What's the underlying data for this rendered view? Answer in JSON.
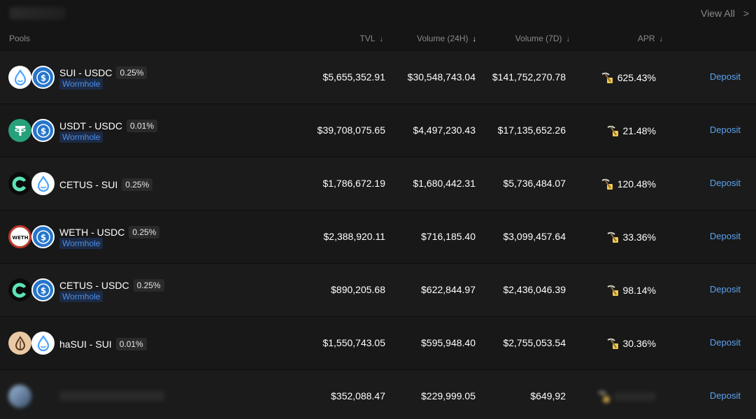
{
  "top": {
    "view_all": "View All",
    "view_all_chevron": ">"
  },
  "header": {
    "pools": "Pools",
    "tvl": "TVL",
    "volume_24h": "Volume (24H)",
    "volume_7d": "Volume (7D)",
    "apr": "APR",
    "arrow": "↓"
  },
  "rows": [
    {
      "coin_a": "sui-icon",
      "coin_b": "usdc-icon",
      "pair": "SUI - USDC",
      "fee": "0.25%",
      "tag": "Wormhole",
      "tvl": "$5,655,352.91",
      "vol24": "$30,548,743.04",
      "vol7": "$141,752,270.78",
      "apr": "625.43%",
      "deposit": "Deposit"
    },
    {
      "coin_a": "usdt-icon",
      "coin_b": "usdc-icon",
      "pair": "USDT - USDC",
      "fee": "0.01%",
      "tag": "Wormhole",
      "tvl": "$39,708,075.65",
      "vol24": "$4,497,230.43",
      "vol7": "$17,135,652.26",
      "apr": "21.48%",
      "deposit": "Deposit"
    },
    {
      "coin_a": "cetus-icon",
      "coin_b": "sui-icon",
      "pair": "CETUS - SUI",
      "fee": "0.25%",
      "tag": "",
      "tvl": "$1,786,672.19",
      "vol24": "$1,680,442.31",
      "vol7": "$5,736,484.07",
      "apr": "120.48%",
      "deposit": "Deposit"
    },
    {
      "coin_a": "weth-icon",
      "coin_b": "usdc-icon",
      "pair": "WETH - USDC",
      "fee": "0.25%",
      "tag": "Wormhole",
      "tvl": "$2,388,920.11",
      "vol24": "$716,185.40",
      "vol7": "$3,099,457.64",
      "apr": "33.36%",
      "deposit": "Deposit"
    },
    {
      "coin_a": "cetus-icon",
      "coin_b": "usdc-icon",
      "pair": "CETUS - USDC",
      "fee": "0.25%",
      "tag": "Wormhole",
      "tvl": "$890,205.68",
      "vol24": "$622,844.97",
      "vol7": "$2,436,046.39",
      "apr": "98.14%",
      "deposit": "Deposit"
    },
    {
      "coin_a": "hasui-icon",
      "coin_b": "sui-icon",
      "pair": "haSUI - SUI",
      "fee": "0.01%",
      "tag": "",
      "tvl": "$1,550,743.05",
      "vol24": "$595,948.40",
      "vol7": "$2,755,053.54",
      "apr": "30.36%",
      "deposit": "Deposit"
    },
    {
      "coin_a": "blurred-icon",
      "coin_b": "",
      "pair": "",
      "fee": "",
      "tag": "",
      "tvl": "$352,088.47",
      "vol24": "$229,999.05",
      "vol7": "$649,92",
      "apr": "",
      "deposit": "Deposit"
    }
  ],
  "colors": {
    "accent": "#5aa3f0",
    "tag_text": "#4c8fe6",
    "tag_bg": "#1c2a45",
    "muted": "#8a8a8a"
  }
}
